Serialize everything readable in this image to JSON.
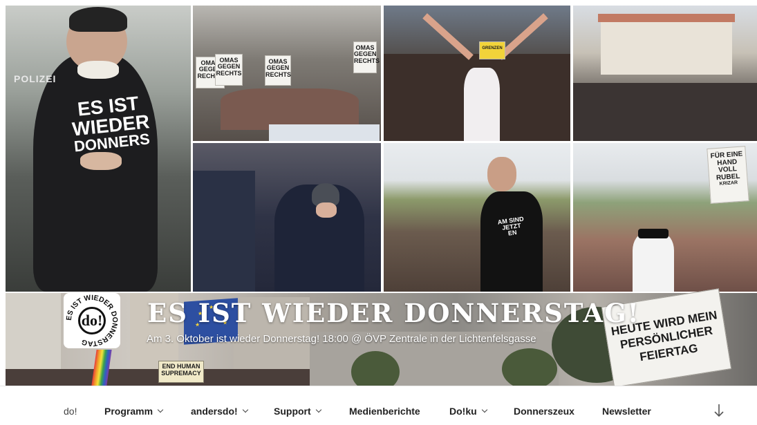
{
  "site": {
    "title": "ES IST WIEDER DONNERSTAG!",
    "description": "Am 3. Oktober ist wieder Donnerstag! 18:00 @ ÖVP Zentrale in der Lichtenfelsgasse",
    "logo_text": "do!",
    "logo_ring_text": "ES IST WIEDER DONNERSTAG"
  },
  "photos": {
    "shirt_text": [
      "ES IST",
      "WIEDER",
      "DONNERS"
    ],
    "police_label": "POLIZEI",
    "omas_sign": [
      "OMAS",
      "GEGEN",
      "RECHTS"
    ],
    "mini_sign": [
      "GRENZEN"
    ],
    "blade_sign": [
      "FÜR EINE",
      "HAND",
      "VOLL",
      "RUBEL",
      "KRIZAR"
    ],
    "shirt_text_2": [
      "AM SIND",
      "JETZT",
      "EN"
    ]
  },
  "header_signs": {
    "right_sign": [
      "HEUTE WIRD MEIN",
      "PERSÖNLICHER",
      "FEIERTAG"
    ],
    "small_sign": [
      "END HUMAN",
      "SUPREMACY"
    ]
  },
  "nav": {
    "items": [
      {
        "label": "do!",
        "has_dropdown": false
      },
      {
        "label": "Programm",
        "has_dropdown": true
      },
      {
        "label": "andersdo!",
        "has_dropdown": true
      },
      {
        "label": "Support",
        "has_dropdown": true
      },
      {
        "label": "Medienberichte",
        "has_dropdown": false
      },
      {
        "label": "Do!ku",
        "has_dropdown": true
      },
      {
        "label": "Donnerszeux",
        "has_dropdown": false
      },
      {
        "label": "Newsletter",
        "has_dropdown": false
      }
    ],
    "scroll_icon": "arrow-down-icon"
  },
  "colors": {
    "title_text": "#ffffff",
    "nav_text": "#222222",
    "background": "#ffffff",
    "eu_blue": "#2d4fa1"
  }
}
